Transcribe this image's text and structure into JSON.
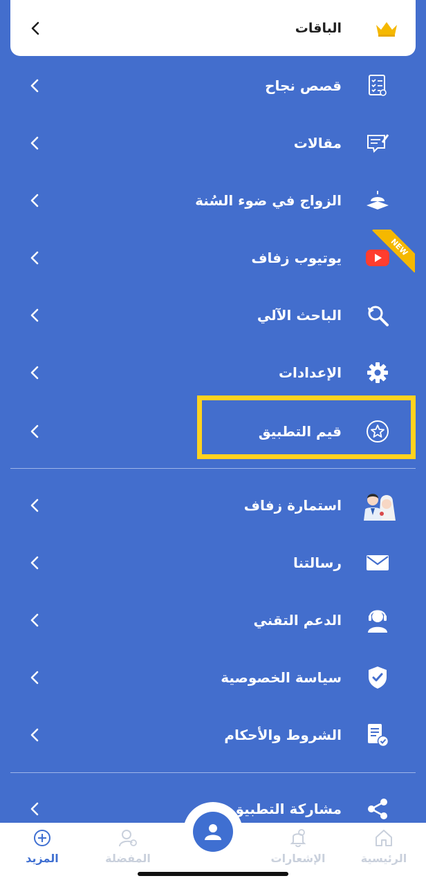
{
  "packages": {
    "label": "الباقات",
    "icon": "crown-icon"
  },
  "menu_group_1": [
    {
      "label": "قصص نجاح",
      "icon": "checklist-icon"
    },
    {
      "label": "مقالات",
      "icon": "article-edit-icon"
    },
    {
      "label": "الزواج في ضوء السُنة",
      "icon": "mosque-book-icon"
    },
    {
      "label": "يوتيوب زفاف",
      "icon": "youtube-icon",
      "badge": "NEW"
    },
    {
      "label": "الباحث الآلي",
      "icon": "search-refresh-icon"
    },
    {
      "label": "الإعدادات",
      "icon": "gear-icon"
    },
    {
      "label": "قيم التطبيق",
      "icon": "star-circle-icon"
    }
  ],
  "menu_group_2": [
    {
      "label": "استمارة زفاف",
      "icon": "bride-groom-icon"
    },
    {
      "label": "رسالتنا",
      "icon": "envelope-icon"
    },
    {
      "label": "الدعم التقني",
      "icon": "support-agent-icon"
    },
    {
      "label": "سياسة الخصوصية",
      "icon": "shield-check-icon"
    },
    {
      "label": "الشروط والأحكام",
      "icon": "document-check-icon"
    }
  ],
  "menu_group_3": [
    {
      "label": "مشاركة التطبيق",
      "icon": "share-icon"
    }
  ],
  "bottom_nav": {
    "home": "الرئيسية",
    "notifications": "الإشعارات",
    "favorites": "المفضلة",
    "more": "المزيد",
    "active": "more"
  },
  "colors": {
    "background": "#436ecd",
    "highlight": "#ffd21f",
    "accent": "#3f6fd1",
    "youtube": "#ff3d2e"
  }
}
